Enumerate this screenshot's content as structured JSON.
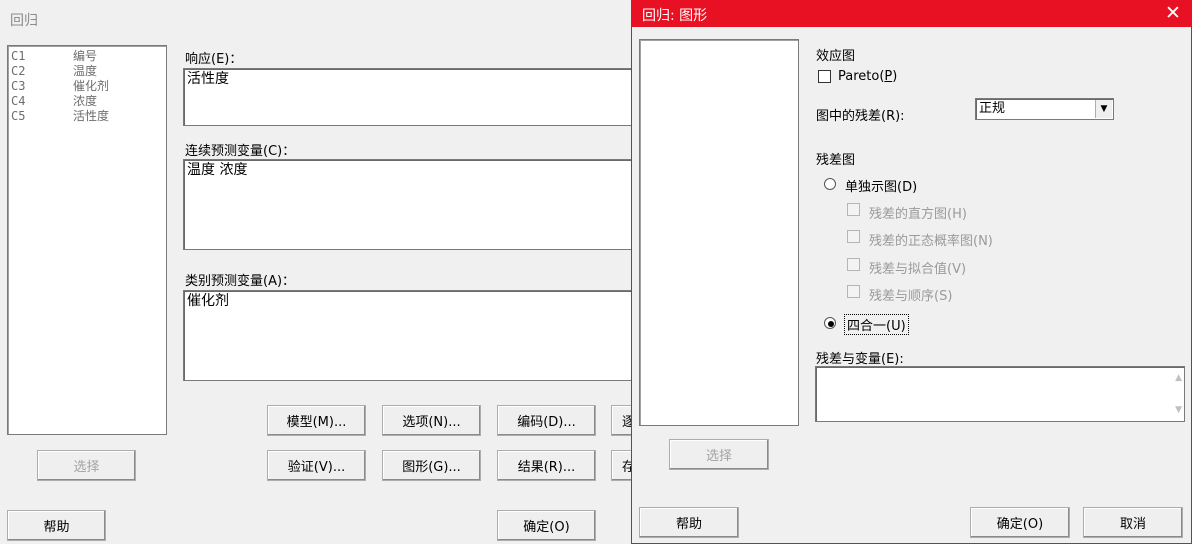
{
  "main_dialog": {
    "title": "回归",
    "columns": [
      {
        "id": "C1",
        "name": "编号"
      },
      {
        "id": "C2",
        "name": "温度"
      },
      {
        "id": "C3",
        "name": "催化剂"
      },
      {
        "id": "C4",
        "name": "浓度"
      },
      {
        "id": "C5",
        "name": "活性度"
      }
    ],
    "response_label": "响应(E)：",
    "response_value": "活性度",
    "continuous_label": "连续预测变量(C)：",
    "continuous_value": "温度 浓度",
    "categorical_label": "类别预测变量(A)：",
    "categorical_value": "催化剂",
    "buttons": {
      "model": "模型(M)...",
      "options": "选项(N)...",
      "coding": "编码(D)...",
      "partial_right_1": "逐",
      "validation": "验证(V)...",
      "graphs": "图形(G)...",
      "results": "结果(R)...",
      "partial_right_2": "存",
      "select": "选择",
      "help": "帮助",
      "ok": "确定(O)"
    }
  },
  "graph_dialog": {
    "title": "回归: 图形",
    "close_icon": "close-icon",
    "effects_plots_label": "效应图",
    "pareto_label": "Pareto(P)",
    "pareto_checked": false,
    "residuals_for_plots_label": "图中的残差(R):",
    "residuals_for_plots_value": "正规",
    "residual_plots_label": "残差图",
    "individual_plots_label": "单独示图(D)",
    "individual_selected": false,
    "histogram_label": "残差的直方图(H)",
    "normal_plot_label": "残差的正态概率图(N)",
    "vs_fits_label": "残差与拟合值(V)",
    "vs_order_label": "残差与顺序(S)",
    "four_in_one_label": "四合一(U)",
    "four_in_one_selected": true,
    "residuals_vs_vars_label": "残差与变量(E):",
    "residuals_vs_vars_value": "",
    "select_button": "选择",
    "help_button": "帮助",
    "ok_button": "确定(O)",
    "cancel_button": "取消"
  }
}
